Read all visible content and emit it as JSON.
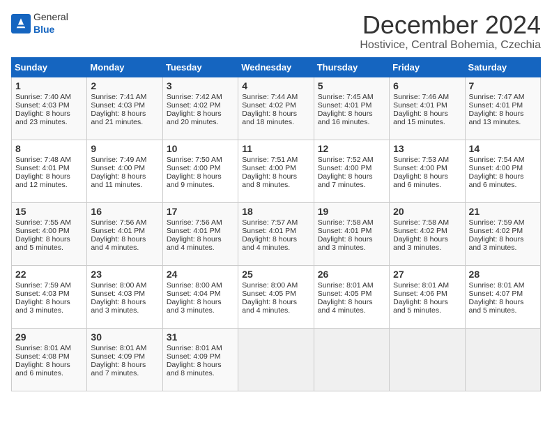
{
  "header": {
    "logo": {
      "general": "General",
      "blue": "Blue"
    },
    "title": "December 2024",
    "location": "Hostivice, Central Bohemia, Czechia"
  },
  "weekdays": [
    "Sunday",
    "Monday",
    "Tuesday",
    "Wednesday",
    "Thursday",
    "Friday",
    "Saturday"
  ],
  "weeks": [
    [
      {
        "day": "1",
        "sunrise": "7:40 AM",
        "sunset": "4:03 PM",
        "daylight": "8 hours and 23 minutes."
      },
      {
        "day": "2",
        "sunrise": "7:41 AM",
        "sunset": "4:03 PM",
        "daylight": "8 hours and 21 minutes."
      },
      {
        "day": "3",
        "sunrise": "7:42 AM",
        "sunset": "4:02 PM",
        "daylight": "8 hours and 20 minutes."
      },
      {
        "day": "4",
        "sunrise": "7:44 AM",
        "sunset": "4:02 PM",
        "daylight": "8 hours and 18 minutes."
      },
      {
        "day": "5",
        "sunrise": "7:45 AM",
        "sunset": "4:01 PM",
        "daylight": "8 hours and 16 minutes."
      },
      {
        "day": "6",
        "sunrise": "7:46 AM",
        "sunset": "4:01 PM",
        "daylight": "8 hours and 15 minutes."
      },
      {
        "day": "7",
        "sunrise": "7:47 AM",
        "sunset": "4:01 PM",
        "daylight": "8 hours and 13 minutes."
      }
    ],
    [
      {
        "day": "8",
        "sunrise": "7:48 AM",
        "sunset": "4:01 PM",
        "daylight": "8 hours and 12 minutes."
      },
      {
        "day": "9",
        "sunrise": "7:49 AM",
        "sunset": "4:00 PM",
        "daylight": "8 hours and 11 minutes."
      },
      {
        "day": "10",
        "sunrise": "7:50 AM",
        "sunset": "4:00 PM",
        "daylight": "8 hours and 9 minutes."
      },
      {
        "day": "11",
        "sunrise": "7:51 AM",
        "sunset": "4:00 PM",
        "daylight": "8 hours and 8 minutes."
      },
      {
        "day": "12",
        "sunrise": "7:52 AM",
        "sunset": "4:00 PM",
        "daylight": "8 hours and 7 minutes."
      },
      {
        "day": "13",
        "sunrise": "7:53 AM",
        "sunset": "4:00 PM",
        "daylight": "8 hours and 6 minutes."
      },
      {
        "day": "14",
        "sunrise": "7:54 AM",
        "sunset": "4:00 PM",
        "daylight": "8 hours and 6 minutes."
      }
    ],
    [
      {
        "day": "15",
        "sunrise": "7:55 AM",
        "sunset": "4:00 PM",
        "daylight": "8 hours and 5 minutes."
      },
      {
        "day": "16",
        "sunrise": "7:56 AM",
        "sunset": "4:01 PM",
        "daylight": "8 hours and 4 minutes."
      },
      {
        "day": "17",
        "sunrise": "7:56 AM",
        "sunset": "4:01 PM",
        "daylight": "8 hours and 4 minutes."
      },
      {
        "day": "18",
        "sunrise": "7:57 AM",
        "sunset": "4:01 PM",
        "daylight": "8 hours and 4 minutes."
      },
      {
        "day": "19",
        "sunrise": "7:58 AM",
        "sunset": "4:01 PM",
        "daylight": "8 hours and 3 minutes."
      },
      {
        "day": "20",
        "sunrise": "7:58 AM",
        "sunset": "4:02 PM",
        "daylight": "8 hours and 3 minutes."
      },
      {
        "day": "21",
        "sunrise": "7:59 AM",
        "sunset": "4:02 PM",
        "daylight": "8 hours and 3 minutes."
      }
    ],
    [
      {
        "day": "22",
        "sunrise": "7:59 AM",
        "sunset": "4:03 PM",
        "daylight": "8 hours and 3 minutes."
      },
      {
        "day": "23",
        "sunrise": "8:00 AM",
        "sunset": "4:03 PM",
        "daylight": "8 hours and 3 minutes."
      },
      {
        "day": "24",
        "sunrise": "8:00 AM",
        "sunset": "4:04 PM",
        "daylight": "8 hours and 3 minutes."
      },
      {
        "day": "25",
        "sunrise": "8:00 AM",
        "sunset": "4:05 PM",
        "daylight": "8 hours and 4 minutes."
      },
      {
        "day": "26",
        "sunrise": "8:01 AM",
        "sunset": "4:05 PM",
        "daylight": "8 hours and 4 minutes."
      },
      {
        "day": "27",
        "sunrise": "8:01 AM",
        "sunset": "4:06 PM",
        "daylight": "8 hours and 5 minutes."
      },
      {
        "day": "28",
        "sunrise": "8:01 AM",
        "sunset": "4:07 PM",
        "daylight": "8 hours and 5 minutes."
      }
    ],
    [
      {
        "day": "29",
        "sunrise": "8:01 AM",
        "sunset": "4:08 PM",
        "daylight": "8 hours and 6 minutes."
      },
      {
        "day": "30",
        "sunrise": "8:01 AM",
        "sunset": "4:09 PM",
        "daylight": "8 hours and 7 minutes."
      },
      {
        "day": "31",
        "sunrise": "8:01 AM",
        "sunset": "4:09 PM",
        "daylight": "8 hours and 8 minutes."
      },
      null,
      null,
      null,
      null
    ]
  ],
  "labels": {
    "sunrise": "Sunrise:",
    "sunset": "Sunset:",
    "daylight": "Daylight:"
  }
}
